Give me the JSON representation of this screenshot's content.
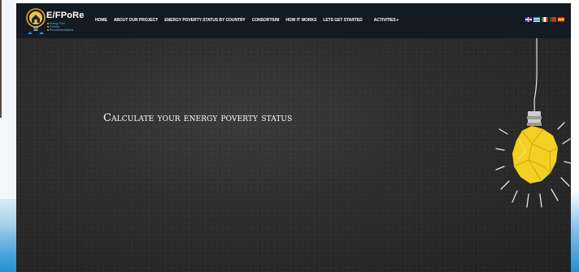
{
  "site": {
    "logo": {
      "title": "E/FPoRe",
      "lines": [
        "Energy Fuel",
        "Poverty",
        "Recommendations"
      ]
    },
    "nav": [
      "HOME",
      "ABOUT OUR PROJECT",
      "ENERGY POVERTY STATUS BY COUNTRY",
      "CONSORTIUM",
      "HOW IT WORKS",
      "LETS GET STARTED",
      "ACTIVITIES"
    ],
    "flags": [
      "english",
      "greek",
      "italian",
      "portuguese",
      "spanish"
    ],
    "hero": {
      "title": "Calculate your energy poverty status"
    }
  },
  "colors": {
    "navbar": "#141a22",
    "hero": "#2d2d2d",
    "accent_yellow": "#f2d024",
    "logo_blue": "#5fb3e6"
  },
  "icons": [
    "lightbulb-house-logo-icon",
    "chevron-down-icon",
    "crumpled-paper-lightbulb-icon"
  ]
}
